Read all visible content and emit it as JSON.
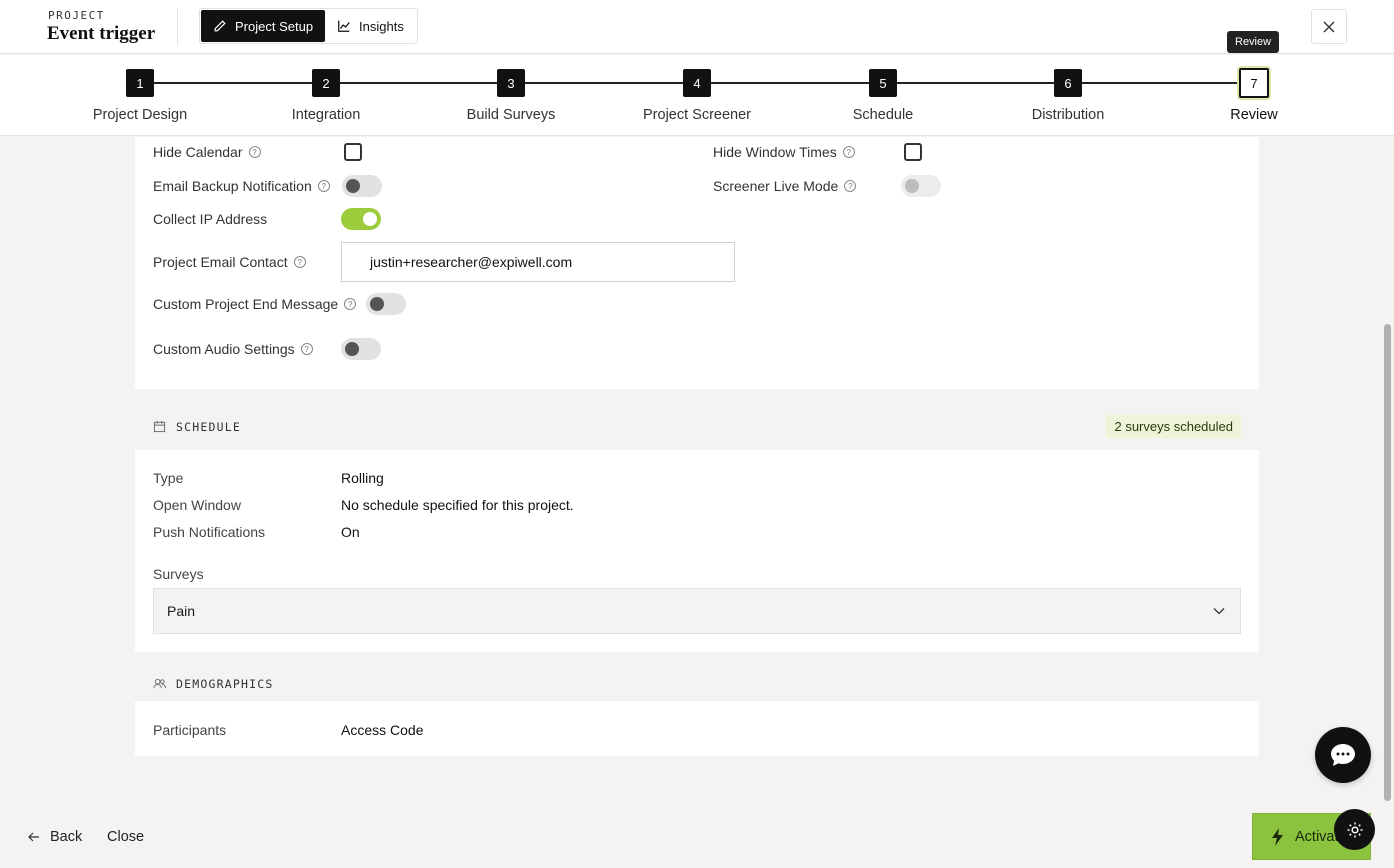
{
  "header": {
    "kicker": "PROJECT",
    "title": "Event trigger",
    "tabs": [
      {
        "label": "Project Setup",
        "icon": "pencil-icon",
        "active": true
      },
      {
        "label": "Insights",
        "icon": "chart-line-icon",
        "active": false
      }
    ],
    "close_icon": "close-icon",
    "tooltip": "Review"
  },
  "stepper": {
    "steps": [
      {
        "num": "1",
        "label": "Project Design"
      },
      {
        "num": "2",
        "label": "Integration"
      },
      {
        "num": "3",
        "label": "Build Surveys"
      },
      {
        "num": "4",
        "label": "Project Screener"
      },
      {
        "num": "5",
        "label": "Schedule"
      },
      {
        "num": "6",
        "label": "Distribution"
      },
      {
        "num": "7",
        "label": "Review",
        "current": true
      }
    ]
  },
  "settings": {
    "hide_calendar": "Hide Calendar",
    "hide_window_times": "Hide Window Times",
    "email_backup": "Email Backup Notification",
    "screener_live": "Screener Live Mode",
    "collect_ip": "Collect IP Address",
    "email_contact": "Project Email Contact",
    "email_value": "justin+researcher@expiwell.com",
    "custom_end": "Custom Project End Message",
    "custom_audio": "Custom Audio Settings"
  },
  "schedule": {
    "title": "SCHEDULE",
    "badge": "2 surveys scheduled",
    "type_label": "Type",
    "type_value": "Rolling",
    "window_label": "Open Window",
    "window_value": "No schedule specified for this project.",
    "push_label": "Push Notifications",
    "push_value": "On",
    "surveys_label": "Surveys",
    "surveys_selected": "Pain"
  },
  "demographics": {
    "title": "DEMOGRAPHICS",
    "participants_label": "Participants",
    "participants_value": "Access Code"
  },
  "footer": {
    "back": "Back",
    "close": "Close",
    "activate": "Activate"
  },
  "colors": {
    "accent": "#8cc33e",
    "toggle_on": "#9ccc3c",
    "dark": "#111111",
    "badge_bg": "#eef4d8"
  }
}
